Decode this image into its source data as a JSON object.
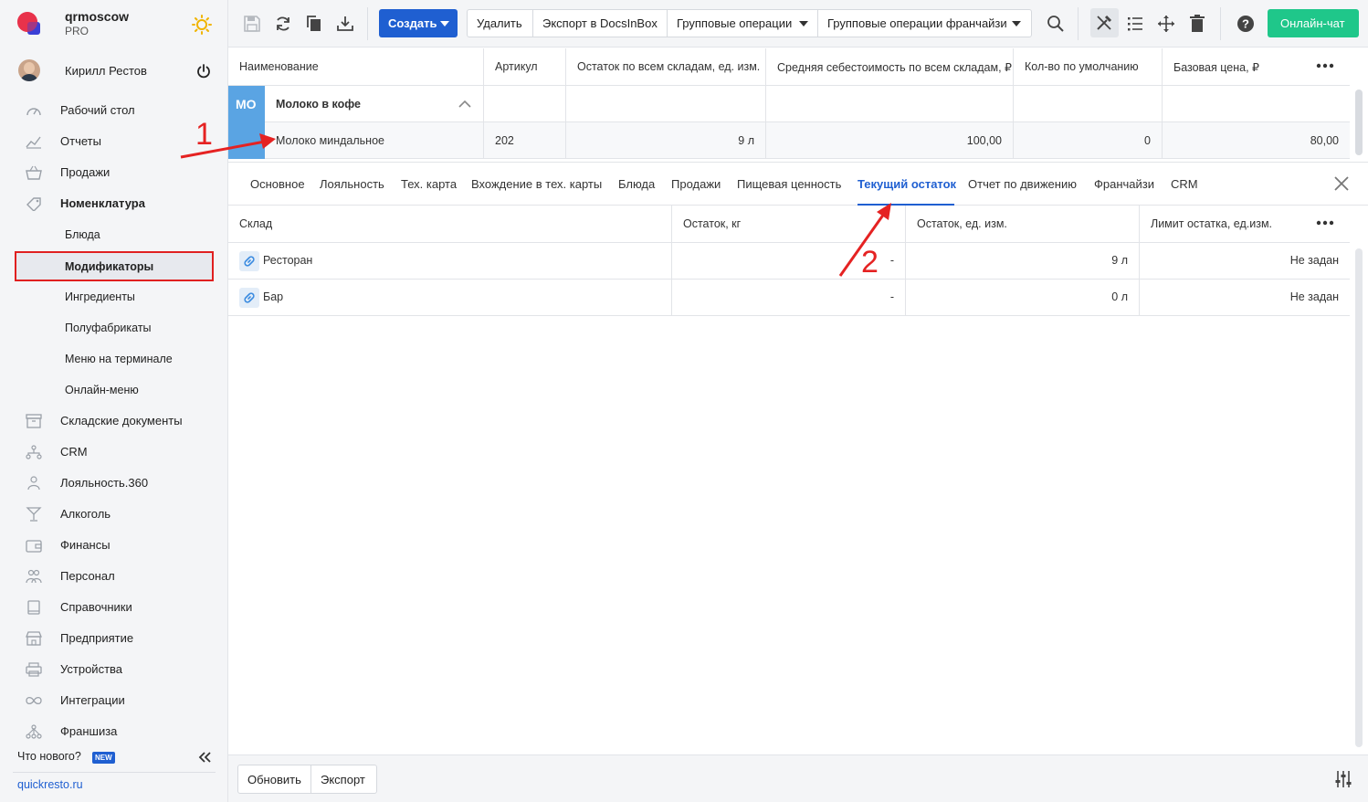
{
  "brand": {
    "title": "qrmoscow",
    "plan": "PRO"
  },
  "user": {
    "name": "Кирилл Рестов"
  },
  "sidebar": {
    "items": [
      {
        "label": "Рабочий стол",
        "icon": "speedometer-icon"
      },
      {
        "label": "Отчеты",
        "icon": "chart-icon"
      },
      {
        "label": "Продажи",
        "icon": "basket-icon"
      },
      {
        "label": "Номенклатура",
        "icon": "tag-icon"
      },
      {
        "label": "Складские документы",
        "icon": "archive-icon"
      },
      {
        "label": "CRM",
        "icon": "hierarchy-icon"
      },
      {
        "label": "Лояльность.360",
        "icon": "loyalty-icon"
      },
      {
        "label": "Алкоголь",
        "icon": "cocktail-icon"
      },
      {
        "label": "Финансы",
        "icon": "wallet-icon"
      },
      {
        "label": "Персонал",
        "icon": "people-icon"
      },
      {
        "label": "Справочники",
        "icon": "book-icon"
      },
      {
        "label": "Предприятие",
        "icon": "store-icon"
      },
      {
        "label": "Устройства",
        "icon": "printer-icon"
      },
      {
        "label": "Интеграции",
        "icon": "infinity-icon"
      },
      {
        "label": "Франшиза",
        "icon": "network-icon"
      }
    ],
    "subitems": [
      {
        "label": "Блюда"
      },
      {
        "label": "Модификаторы"
      },
      {
        "label": "Ингредиенты"
      },
      {
        "label": "Полуфабрикаты"
      },
      {
        "label": "Меню на терминале"
      },
      {
        "label": "Онлайн-меню"
      }
    ],
    "whatsnew": "Что нового?",
    "new_badge": "NEW",
    "site_link": "quickresto.ru"
  },
  "toolbar": {
    "create_label": "Создать",
    "delete_label": "Удалить",
    "export_docsinbox_label": "Экспорт в DocsInBox",
    "group_ops_label": "Групповые операции",
    "group_ops_franchise_label": "Групповые операции франчайзи",
    "chat_label": "Онлайн-чат"
  },
  "main_table": {
    "columns": [
      "Наименование",
      "Артикул",
      "Остаток по всем складам, ед. изм.",
      "Средняя себестоимость по всем складам, ₽",
      "Кол-во по умолчанию",
      "Базовая цена, ₽"
    ],
    "group": {
      "badge": "МО",
      "name": "Молоко в кофе"
    },
    "row": {
      "name": "Молоко миндальное",
      "article": "202",
      "stock": "9 л",
      "avg_cost": "100,00",
      "default_qty": "0",
      "base_price": "80,00"
    }
  },
  "tabs": [
    "Основное",
    "Лояльность",
    "Тех. карта",
    "Вхождение в тех. карты",
    "Блюда",
    "Продажи",
    "Пищевая ценность",
    "Текущий остаток",
    "Отчет по движению",
    "Франчайзи",
    "CRM"
  ],
  "stock_table": {
    "columns": [
      "Склад",
      "Остаток, кг",
      "Остаток, ед. изм.",
      "Лимит остатка, ед.изм."
    ],
    "rows": [
      {
        "warehouse": "Ресторан",
        "kg": "-",
        "units": "9 л",
        "limit": "Не задан"
      },
      {
        "warehouse": "Бар",
        "kg": "-",
        "units": "0 л",
        "limit": "Не задан"
      }
    ]
  },
  "bottombar": {
    "refresh_label": "Обновить",
    "export_label": "Экспорт"
  },
  "annotations": {
    "first": "1",
    "second": "2"
  },
  "colors": {
    "accent": "#1f5fd1",
    "chat": "#1fc78a",
    "badge": "#5aa4e3",
    "annotation": "#e52222"
  }
}
